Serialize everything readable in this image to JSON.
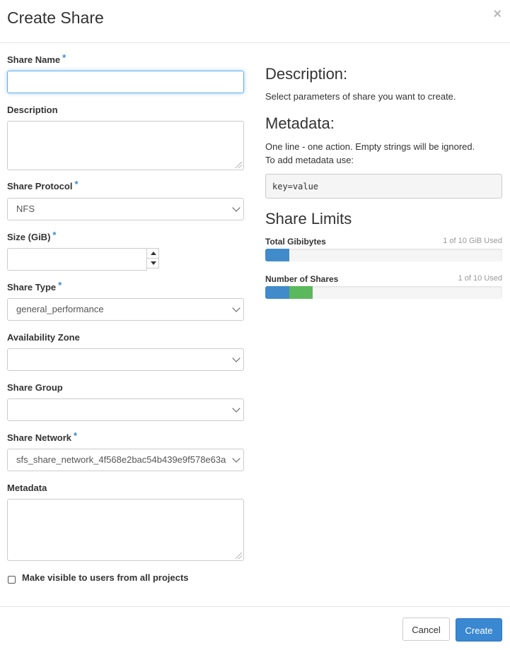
{
  "modal": {
    "title": "Create Share",
    "close_glyph": "×"
  },
  "form": {
    "share_name": {
      "label": "Share Name",
      "required": "*",
      "value": ""
    },
    "description": {
      "label": "Description",
      "value": ""
    },
    "share_protocol": {
      "label": "Share Protocol",
      "required": "*",
      "selected": "NFS"
    },
    "size": {
      "label": "Size (GiB)",
      "required": "*",
      "value": ""
    },
    "share_type": {
      "label": "Share Type",
      "required": "*",
      "selected": "general_performance"
    },
    "availability_zone": {
      "label": "Availability Zone",
      "selected": ""
    },
    "share_group": {
      "label": "Share Group",
      "selected": ""
    },
    "share_network": {
      "label": "Share Network",
      "required": "*",
      "selected": "sfs_share_network_4f568e2bac54b439e9f578e63a"
    },
    "metadata": {
      "label": "Metadata",
      "value": ""
    },
    "public": {
      "label": "Make visible to users from all projects",
      "checked": false
    }
  },
  "help": {
    "description_heading": "Description:",
    "description_text": "Select parameters of share you want to create.",
    "metadata_heading": "Metadata:",
    "metadata_line1": "One line - one action. Empty strings will be ignored.",
    "metadata_line2": "To add metadata use:",
    "metadata_example": "key=value"
  },
  "limits": {
    "heading": "Share Limits",
    "gibibytes": {
      "label": "Total Gibibytes",
      "used_text": "1 of 10 GiB Used",
      "used_fraction": 0.1,
      "used_color": "#428bca"
    },
    "shares": {
      "label": "Number of Shares",
      "used_text": "1 of 10 Used",
      "used_fraction": 0.1,
      "added_fraction": 0.1,
      "used_color": "#428bca",
      "added_color": "#5cb85c"
    }
  },
  "footer": {
    "cancel_label": "Cancel",
    "create_label": "Create"
  }
}
